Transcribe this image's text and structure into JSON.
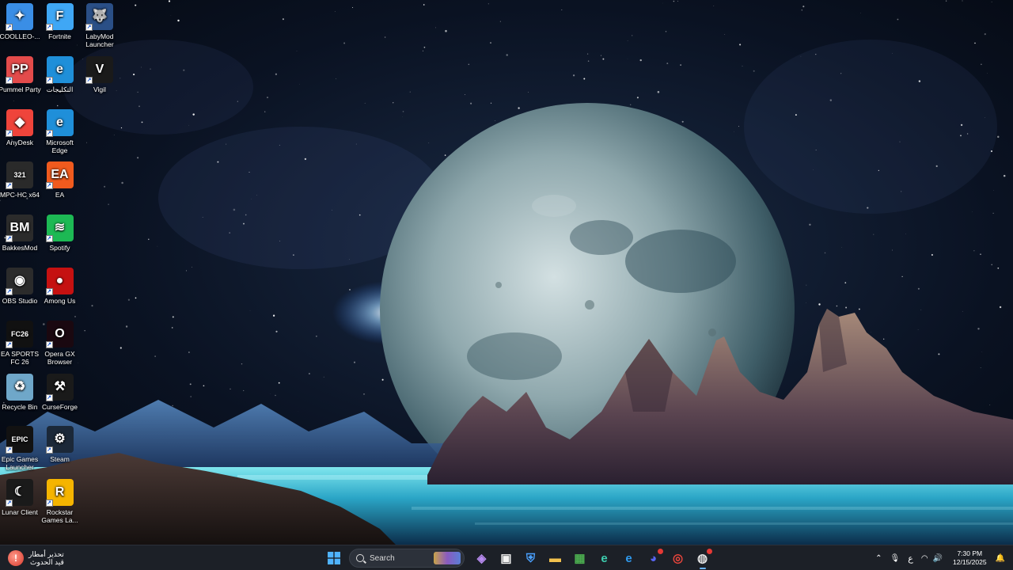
{
  "desktop": {
    "icons": [
      {
        "label": "COOLLEO-...",
        "icon": "cooleo-icon",
        "color": "#3a8ee6",
        "glyph": "✦"
      },
      {
        "label": "Fortnite",
        "icon": "fortnite-icon",
        "color": "#3fa7f5",
        "glyph": "F"
      },
      {
        "label": "LabyMod Launcher",
        "icon": "labymod-icon",
        "color": "#2a4f86",
        "glyph": "🐺"
      },
      {
        "label": "Pummel Party",
        "icon": "pummel-party-icon",
        "color": "#e34b4b",
        "glyph": "PP"
      },
      {
        "label": "التكليجات",
        "icon": "edge-beta-icon",
        "color": "#1f8fd9",
        "glyph": "e"
      },
      {
        "label": "Vigil",
        "icon": "vigil-icon",
        "color": "#1a1a1a",
        "glyph": "V"
      },
      {
        "label": "AnyDesk",
        "icon": "anydesk-icon",
        "color": "#ef443b",
        "glyph": "◆"
      },
      {
        "label": "Microsoft Edge",
        "icon": "edge-icon",
        "color": "#1f8fd9",
        "glyph": "e"
      },
      {
        "label": "MPC-HC x64",
        "icon": "mpc-hc-icon",
        "color": "#2a2a2a",
        "glyph": "321"
      },
      {
        "label": "EA",
        "icon": "ea-icon",
        "color": "#f05a1e",
        "glyph": "EA"
      },
      {
        "label": "BakkesMod",
        "icon": "bakkesmod-icon",
        "color": "#2b2b2b",
        "glyph": "BM"
      },
      {
        "label": "Spotify",
        "icon": "spotify-icon",
        "color": "#1db954",
        "glyph": "≋"
      },
      {
        "label": "OBS Studio",
        "icon": "obs-icon",
        "color": "#2b2b2b",
        "glyph": "◉"
      },
      {
        "label": "Among Us",
        "icon": "among-us-icon",
        "color": "#c51111",
        "glyph": "●"
      },
      {
        "label": "EA SPORTS FC 26",
        "icon": "fc26-icon",
        "color": "#111111",
        "glyph": "FC26"
      },
      {
        "label": "Opera GX Browser",
        "icon": "opera-gx-icon",
        "color": "#1a0810",
        "glyph": "O"
      },
      {
        "label": "Recycle Bin",
        "icon": "recycle-bin-icon",
        "color": "#6fa7c9",
        "glyph": "♻"
      },
      {
        "label": "CurseForge",
        "icon": "curseforge-icon",
        "color": "#1a1a1a",
        "glyph": "⚒"
      },
      {
        "label": "Epic Games Launcher",
        "icon": "epic-games-icon",
        "color": "#121212",
        "glyph": "EPIC"
      },
      {
        "label": "Steam",
        "icon": "steam-icon",
        "color": "#1b2838",
        "glyph": "⚙"
      },
      {
        "label": "Lunar Client",
        "icon": "lunar-client-icon",
        "color": "#1a1a1a",
        "glyph": "☾"
      },
      {
        "label": "Rockstar Games La...",
        "icon": "rockstar-icon",
        "color": "#f5b400",
        "glyph": "R"
      }
    ]
  },
  "taskbar": {
    "widget": {
      "line1": "تحذير أمطار",
      "line2": "قيد الحدوث"
    },
    "search_placeholder": "Search",
    "apps": [
      {
        "name": "start-button",
        "glyph": "⊞",
        "color": "#4fb3ff"
      },
      {
        "name": "copilot-icon",
        "glyph": "◈",
        "color": "#b98cf2"
      },
      {
        "name": "microsoft-store-icon",
        "glyph": "▣",
        "color": "#f3f3f3"
      },
      {
        "name": "defender-icon",
        "glyph": "⛨",
        "color": "#4aa0ff"
      },
      {
        "name": "file-explorer-icon",
        "glyph": "▬",
        "color": "#f2c14e"
      },
      {
        "name": "minecraft-icon",
        "glyph": "▦",
        "color": "#4caf50"
      },
      {
        "name": "edge-dev-icon",
        "glyph": "e",
        "color": "#3ecfb0"
      },
      {
        "name": "edge-taskbar-icon",
        "glyph": "e",
        "color": "#2f9bf0"
      },
      {
        "name": "discord-icon",
        "glyph": "◕",
        "color": "#5865f2"
      },
      {
        "name": "chrome-icon",
        "glyph": "◎",
        "color": "#e8453c"
      },
      {
        "name": "app-active-icon",
        "glyph": "◍",
        "color": "#e0e0e0"
      }
    ],
    "tray": {
      "chevron": "⌃",
      "mic": "🎙",
      "language": "ع",
      "wifi": "◠",
      "volume": "🔊",
      "time": "7:30 PM",
      "date": "12/15/2025",
      "notification": "🔔"
    }
  }
}
